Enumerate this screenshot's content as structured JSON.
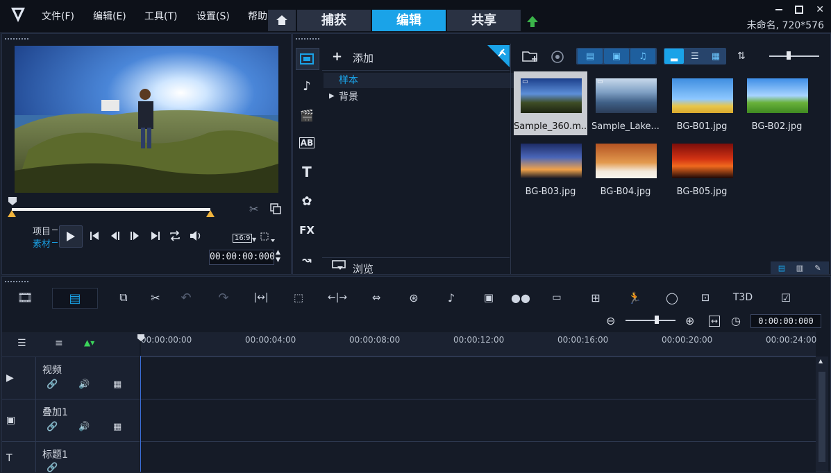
{
  "menu": {
    "file": "文件(F)",
    "edit": "编辑(E)",
    "tools": "工具(T)",
    "settings": "设置(S)",
    "help": "帮助"
  },
  "tabs": {
    "capture": "捕获",
    "edit": "编辑",
    "share": "共享"
  },
  "project_info": "未命名, 720*576",
  "preview": {
    "mode_project": "项目",
    "mode_clip": "素材",
    "aspect": "16:9",
    "timecode": "00:00:00:000"
  },
  "library": {
    "add_label": "添加",
    "folders": [
      "样本",
      "背景"
    ],
    "browse_label": "浏览",
    "thumbs": [
      {
        "label": "Sample_360.m...",
        "type": "video"
      },
      {
        "label": "Sample_Lake...",
        "type": "video"
      },
      {
        "label": "BG-B01.jpg",
        "type": "image"
      },
      {
        "label": "BG-B02.jpg",
        "type": "image"
      },
      {
        "label": "BG-B03.jpg",
        "type": "image"
      },
      {
        "label": "BG-B04.jpg",
        "type": "image"
      },
      {
        "label": "BG-B05.jpg",
        "type": "image"
      }
    ],
    "sidebar_labels": {
      "fx": "FX",
      "title": "T",
      "ab": "AB"
    }
  },
  "timeline": {
    "timecode": "0:00:00:000",
    "ruler": [
      "00:00:00:00",
      "00:00:04:00",
      "00:00:08:00",
      "00:00:12:00",
      "00:00:16:00",
      "00:00:20:00",
      "00:00:24:00"
    ],
    "tracks": [
      {
        "name": "视频"
      },
      {
        "name": "叠加1"
      },
      {
        "name": "标题1"
      }
    ],
    "title3d_label": "T3D"
  },
  "colors": {
    "accent": "#1aa3e8",
    "bg": "#1b2230",
    "panel": "#141a26"
  }
}
